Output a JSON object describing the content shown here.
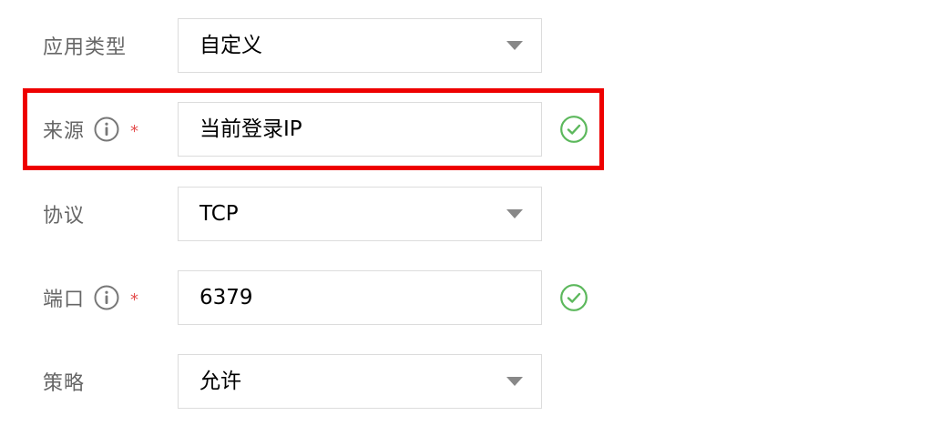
{
  "form": {
    "app_type": {
      "label": "应用类型",
      "value": "自定义",
      "control": "select"
    },
    "source": {
      "label": "来源",
      "value": "当前登录IP",
      "required_mark": "*",
      "control": "input",
      "valid": true,
      "highlighted": true,
      "highlight_color": "#ee0000"
    },
    "protocol": {
      "label": "协议",
      "value": "TCP",
      "control": "select"
    },
    "port": {
      "label": "端口",
      "value": "6379",
      "required_mark": "*",
      "control": "input",
      "valid": true
    },
    "policy": {
      "label": "策略",
      "value": "允许",
      "control": "select"
    }
  },
  "icons": {
    "info": "info-circle-icon",
    "valid": "check-circle-icon",
    "dropdown": "caret-down-icon"
  },
  "colors": {
    "label": "#666666",
    "required": "#e34d4d",
    "valid": "#5cb85c",
    "border": "#dcdcdc",
    "highlight": "#ee0000"
  }
}
